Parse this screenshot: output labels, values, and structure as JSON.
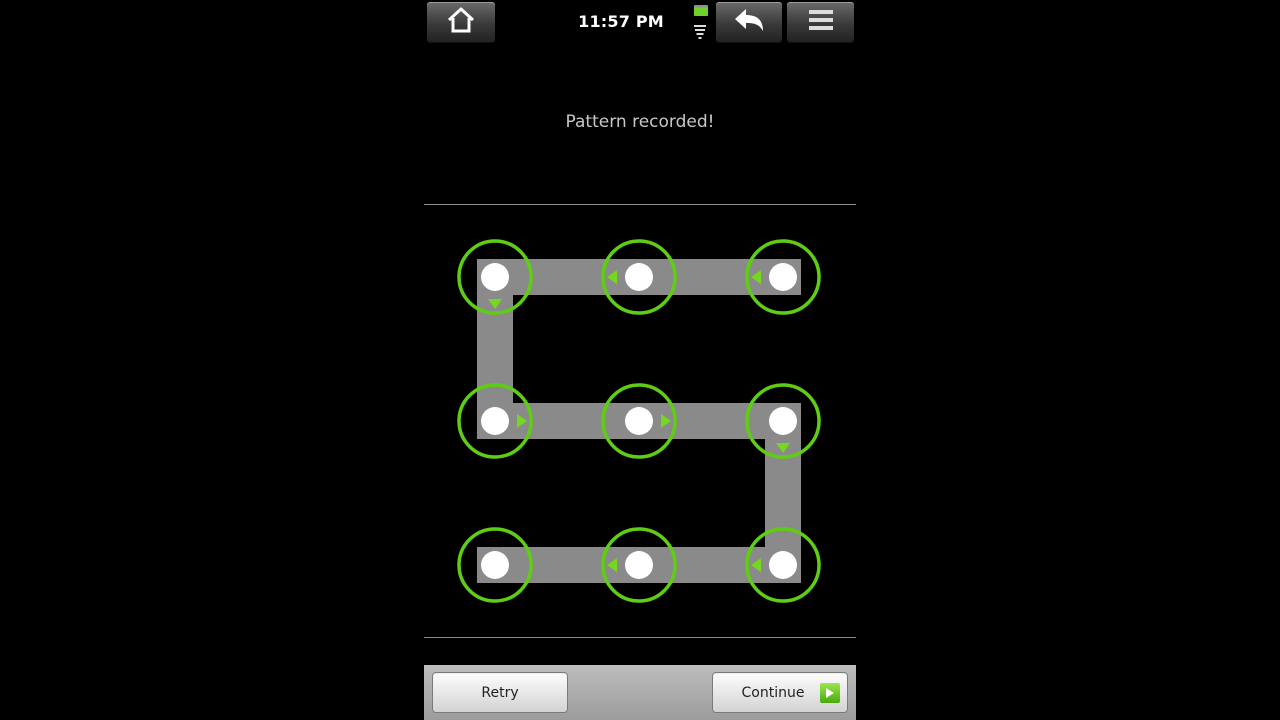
{
  "status_bar": {
    "time": "11:57 PM",
    "home_icon": "home-icon",
    "back_icon": "back-arrow-icon",
    "menu_icon": "menu-icon",
    "battery_icon": "battery-icon",
    "wifi_icon": "wifi-icon"
  },
  "header": {
    "message": "Pattern recorded!"
  },
  "pattern": {
    "grid": 3,
    "sequence": [
      3,
      2,
      1,
      4,
      5,
      6,
      9,
      8,
      7
    ],
    "colors": {
      "ring": "#5fce12",
      "path": "#8a8a8a",
      "arrow": "#74d81e",
      "dot": "#ffffff"
    }
  },
  "footer": {
    "retry_label": "Retry",
    "continue_label": "Continue",
    "continue_icon": "arrow-right-icon"
  }
}
